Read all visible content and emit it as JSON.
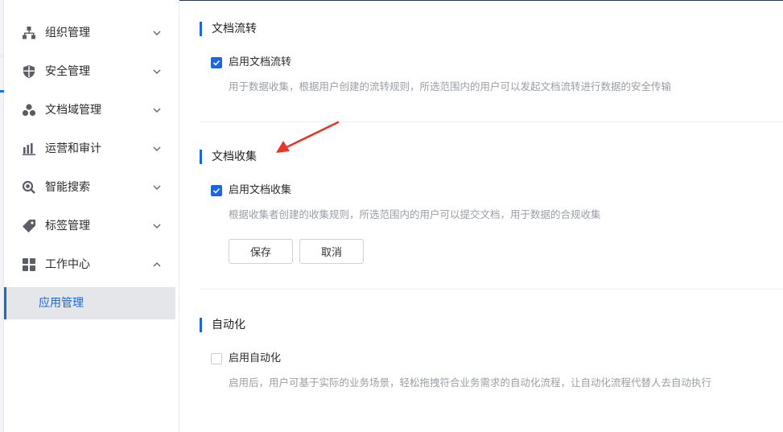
{
  "sidebar": {
    "items": [
      {
        "label": "组织管理",
        "icon": "org-tree-icon",
        "expanded": false
      },
      {
        "label": "安全管理",
        "icon": "shield-icon",
        "expanded": false
      },
      {
        "label": "文档域管理",
        "icon": "domain-cluster-icon",
        "expanded": false
      },
      {
        "label": "运营和审计",
        "icon": "bar-chart-icon",
        "expanded": false
      },
      {
        "label": "智能搜索",
        "icon": "search-icon",
        "expanded": false
      },
      {
        "label": "标签管理",
        "icon": "tag-icon",
        "expanded": false
      },
      {
        "label": "工作中心",
        "icon": "grid-icon",
        "expanded": true
      }
    ],
    "sub_items": [
      {
        "label": "应用管理",
        "active": true
      }
    ]
  },
  "sections": {
    "doc_flow": {
      "title": "文档流转",
      "checkbox_label": "启用文档流转",
      "checked": true,
      "description": "用于数据收集，根据用户创建的流转规则，所选范围内的用户可以发起文档流转进行数据的安全传输"
    },
    "doc_collect": {
      "title": "文档收集",
      "checkbox_label": "启用文档收集",
      "checked": true,
      "description": "根据收集者创建的收集规则，所选范围内的用户可以提交文档，用于数据的合规收集",
      "save_label": "保存",
      "cancel_label": "取消"
    },
    "automation": {
      "title": "自动化",
      "checkbox_label": "启用自动化",
      "checked": false,
      "description": "启用后，用户可基于实际的业务场景，轻松拖拽符合业务需求的自动化流程，让自动化流程代替人去自动执行"
    }
  },
  "colors": {
    "accent": "#1a66e0",
    "annotation_arrow": "#e8352c"
  }
}
